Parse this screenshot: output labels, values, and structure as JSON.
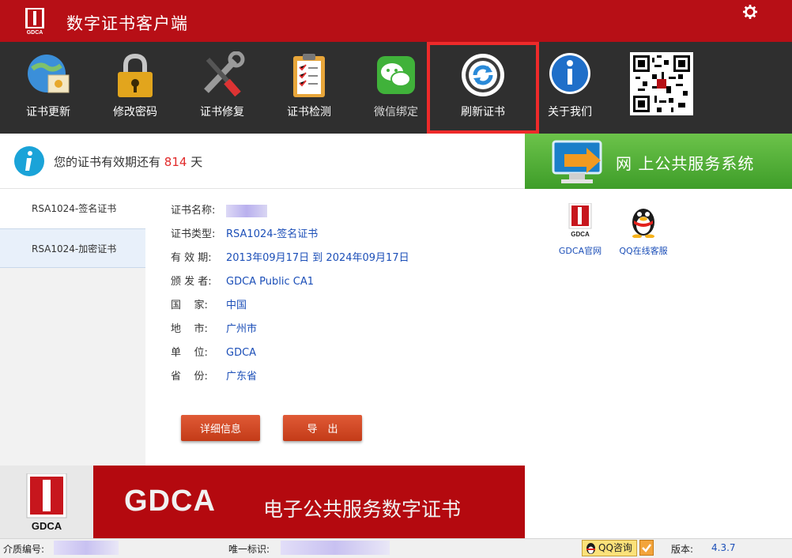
{
  "app": {
    "title": "数字证书客户端",
    "logo_text": "GDCA"
  },
  "toolbar": {
    "items": [
      {
        "label": "证书更新",
        "icon": "globe-certificate-icon"
      },
      {
        "label": "修改密码",
        "icon": "padlock-icon"
      },
      {
        "label": "证书修复",
        "icon": "tools-icon"
      },
      {
        "label": "证书检测",
        "icon": "clipboard-check-icon"
      },
      {
        "label": "微信绑定",
        "icon": "wechat-icon"
      },
      {
        "label": "刷新证书",
        "icon": "refresh-icon",
        "selected": true
      },
      {
        "label": "关于我们",
        "icon": "info-icon"
      }
    ],
    "qr_icon": "qr-code-icon"
  },
  "notice": {
    "prefix": "您的证书有效期还有",
    "days": "814",
    "suffix": "天",
    "days_color": "#e12b2b"
  },
  "sidetabs": [
    {
      "label": "RSA1024-签名证书"
    },
    {
      "label": "RSA1024-加密证书"
    }
  ],
  "cert": {
    "fields": [
      {
        "key": "证书名称:",
        "value": ""
      },
      {
        "key": "证书类型:",
        "value": "RSA1024-签名证书"
      },
      {
        "key": "有 效 期:",
        "value": "2013年09月17日 到 2024年09月17日"
      },
      {
        "key": "颁 发 者:",
        "value": "GDCA Public CA1"
      },
      {
        "key": "国    家:",
        "value": "中国"
      },
      {
        "key": "地    市:",
        "value": "广州市"
      },
      {
        "key": "单    位:",
        "value": "GDCA"
      },
      {
        "key": "省    份:",
        "value": "广东省"
      }
    ],
    "details_button": "详细信息",
    "export_button": "导　出"
  },
  "right_panel": {
    "banner_text": "网 上公共服务系统",
    "links": [
      {
        "label": "GDCA官网",
        "icon": "gdca-logo-icon"
      },
      {
        "label": "QQ在线客服",
        "icon": "qq-penguin-icon"
      }
    ]
  },
  "bottom_banner": {
    "brand": "GDCA",
    "slogan": "电子公共服务数字证书",
    "logo_text": "GDCA"
  },
  "statusbar": {
    "media_label": "介质编号:",
    "uid_label": "唯一标识:",
    "qq_button": "QQ咨询",
    "version_label": "版本:",
    "version": "4.3.7"
  },
  "colors": {
    "brand_red": "#b70f16",
    "toolbar_bg": "#2f2f2f",
    "selected_border": "#ee2a2a",
    "link_blue": "#1c4fb8"
  }
}
